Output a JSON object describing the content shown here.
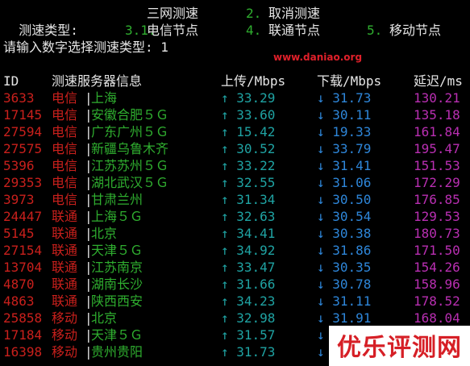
{
  "menu": {
    "title_label": "测速类型:",
    "options_row1": [
      {
        "num": "1.",
        "label": "三网测速"
      },
      {
        "num": "2.",
        "label": "取消测速"
      }
    ],
    "options_row2": [
      {
        "num": "3.",
        "label": "电信节点"
      },
      {
        "num": "4.",
        "label": "联通节点"
      },
      {
        "num": "5.",
        "label": "移动节点"
      }
    ],
    "prompt": "请输入数字选择测速类型: 1"
  },
  "watermark": {
    "url": "www.daniao.org",
    "logo": "优乐评测网"
  },
  "table": {
    "headers": {
      "id": "ID",
      "server": "测速服务器信息",
      "upload": "上传/Mbps",
      "download": "下载/Mbps",
      "latency": "延迟/ms"
    },
    "rows": [
      {
        "id": "3633",
        "isp": "电信",
        "location": "上海",
        "up": "↑ 33.29",
        "down": "↓ 31.73",
        "latency": "130.21"
      },
      {
        "id": "17145",
        "isp": "电信",
        "location": "安徽合肥５Ｇ",
        "up": "↑ 33.60",
        "down": "↓ 30.11",
        "latency": "135.18"
      },
      {
        "id": "27594",
        "isp": "电信",
        "location": "广东广州５Ｇ",
        "up": "↑ 15.42",
        "down": "↓ 19.33",
        "latency": "161.84"
      },
      {
        "id": "27575",
        "isp": "电信",
        "location": "新疆乌鲁木齐",
        "up": "↑ 30.52",
        "down": "↓ 33.79",
        "latency": "195.47"
      },
      {
        "id": "5396",
        "isp": "电信",
        "location": "江苏苏州５Ｇ",
        "up": "↑ 33.22",
        "down": "↓ 31.41",
        "latency": "151.53"
      },
      {
        "id": "29353",
        "isp": "电信",
        "location": "湖北武汉５Ｇ",
        "up": "↑ 32.55",
        "down": "↓ 31.06",
        "latency": "172.29"
      },
      {
        "id": "3973",
        "isp": "电信",
        "location": "甘肃兰州",
        "up": "↑ 31.34",
        "down": "↓ 30.50",
        "latency": "176.85"
      },
      {
        "id": "24447",
        "isp": "联通",
        "location": "上海５Ｇ",
        "up": "↑ 32.63",
        "down": "↓ 30.54",
        "latency": "129.53"
      },
      {
        "id": "5145",
        "isp": "联通",
        "location": "北京",
        "up": "↑ 34.41",
        "down": "↓ 30.38",
        "latency": "180.73"
      },
      {
        "id": "27154",
        "isp": "联通",
        "location": "天津５Ｇ",
        "up": "↑ 34.92",
        "down": "↓ 31.86",
        "latency": "171.50"
      },
      {
        "id": "13704",
        "isp": "联通",
        "location": "江苏南京",
        "up": "↑ 33.47",
        "down": "↓ 30.35",
        "latency": "154.26"
      },
      {
        "id": "4870",
        "isp": "联通",
        "location": "湖南长沙",
        "up": "↑ 31.66",
        "down": "↓ 30.78",
        "latency": "158.96"
      },
      {
        "id": "4863",
        "isp": "联通",
        "location": "陕西西安",
        "up": "↑ 34.23",
        "down": "↓ 31.11",
        "latency": "178.52"
      },
      {
        "id": "25858",
        "isp": "移动",
        "location": "北京",
        "up": "↑ 32.98",
        "down": "↓ 31.91",
        "latency": "168.04"
      },
      {
        "id": "17184",
        "isp": "移动",
        "location": "天津５Ｇ",
        "up": "↑ 31.57",
        "down": "↓",
        "latency": ""
      },
      {
        "id": "16398",
        "isp": "移动",
        "location": "贵州贵阳",
        "up": "↑ 31.73",
        "down": "↓",
        "latency": ""
      }
    ]
  },
  "colors": {
    "background": "#000000",
    "id_isp": "#c9201c",
    "location": "#2fae2f",
    "upload": "#1fa3a3",
    "download": "#2e86d9",
    "latency": "#b92fb2",
    "watermark": "#d61f26"
  }
}
